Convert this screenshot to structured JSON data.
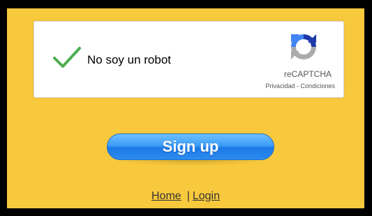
{
  "captcha": {
    "label": "No soy un robot",
    "checked": true,
    "brand": "reCAPTCHA",
    "privacy_label": "Privacidad",
    "link_separator": " - ",
    "terms_label": "Condiciones",
    "check_color": "#4caf50",
    "icons": {
      "check": "checkmark-icon",
      "logo": "recaptcha-logo-icon"
    }
  },
  "signup": {
    "label": "Sign up",
    "color": "#2d8cf0"
  },
  "footer": {
    "home_label": "Home",
    "separator": "|",
    "login_label": "Login"
  },
  "colors": {
    "background": "#f9c93d",
    "frame": "#000000"
  }
}
